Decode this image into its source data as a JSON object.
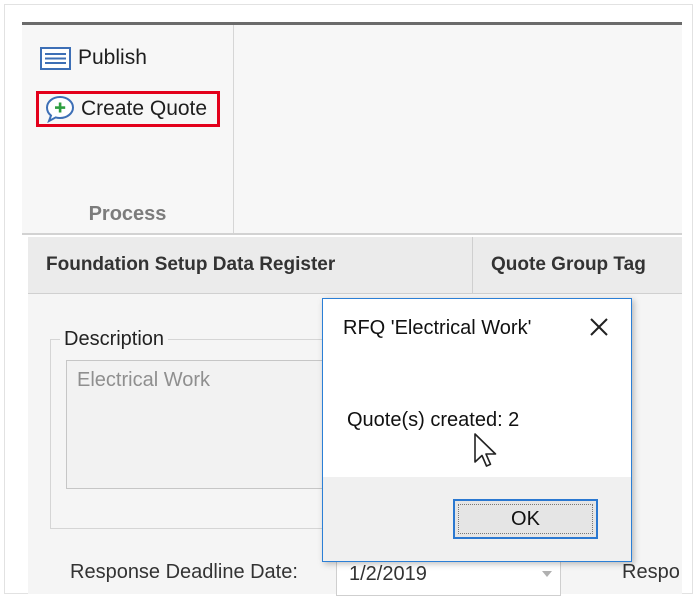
{
  "ribbon": {
    "publish_label": "Publish",
    "create_quote_label": "Create Quote",
    "group_label": "Process",
    "highlight_color": "#e3001b",
    "icons": {
      "publish": "list-icon",
      "create_quote": "speech-bubble-plus-icon"
    }
  },
  "tabs": [
    {
      "label": "Foundation Setup Data Register"
    },
    {
      "label": "Quote Group Tag"
    }
  ],
  "form": {
    "description_label": "Description",
    "description_value": "Electrical Work",
    "deadline_label": "Response Deadline Date:",
    "deadline_value": "1/2/2019",
    "resp_label": "Respo"
  },
  "dialog": {
    "title": "RFQ 'Electrical Work'",
    "message": "Quote(s) created: 2",
    "ok_label": "OK",
    "close_icon": "close-icon",
    "accent_color": "#2b7fd6"
  }
}
